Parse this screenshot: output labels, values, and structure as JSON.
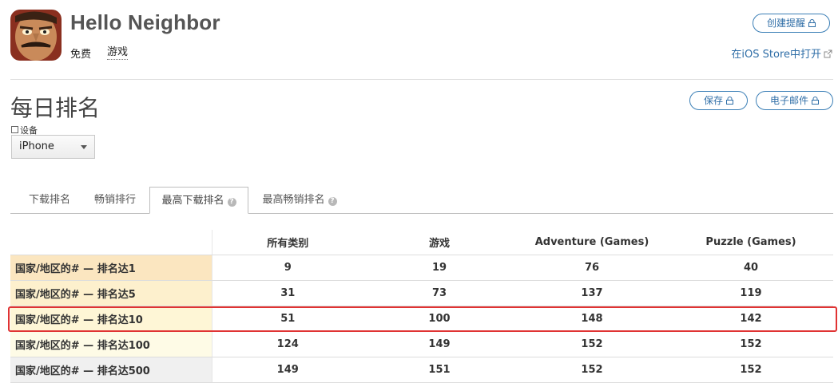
{
  "app": {
    "title": "Hello Neighbor",
    "price": "免费",
    "category": "游戏"
  },
  "actions": {
    "create_alert": "创建提醒",
    "open_store": "在iOS Store中打开",
    "save": "保存",
    "email": "电子邮件"
  },
  "page": {
    "title": "每日排名",
    "device_label": "设备",
    "device_value": "iPhone"
  },
  "tabs": [
    {
      "label": "下载排名",
      "active": false
    },
    {
      "label": "畅销排行",
      "active": false
    },
    {
      "label": "最高下载排名",
      "active": true
    },
    {
      "label": "最高畅销排名",
      "active": false
    }
  ],
  "table": {
    "columns": [
      "所有类别",
      "游戏",
      "Adventure (Games)",
      "Puzzle (Games)"
    ],
    "rows": [
      {
        "label": "国家/地区的# — 排名达1",
        "values": [
          "9",
          "19",
          "76",
          "40"
        ],
        "color": "#fbe6c0"
      },
      {
        "label": "国家/地区的# — 排名达5",
        "values": [
          "31",
          "73",
          "137",
          "119"
        ],
        "color": "#fdf0cd"
      },
      {
        "label": "国家/地区的# — 排名达10",
        "values": [
          "51",
          "100",
          "148",
          "142"
        ],
        "color": "#fef6d6"
      },
      {
        "label": "国家/地区的# — 排名达100",
        "values": [
          "124",
          "149",
          "152",
          "152"
        ],
        "color": "#fefbe6"
      },
      {
        "label": "国家/地区的# — 排名达500",
        "values": [
          "149",
          "151",
          "152",
          "152"
        ],
        "color": "#f0f0f0"
      }
    ]
  },
  "colors": {
    "accent": "#2f6ea7",
    "highlight_border": "#e03333"
  }
}
